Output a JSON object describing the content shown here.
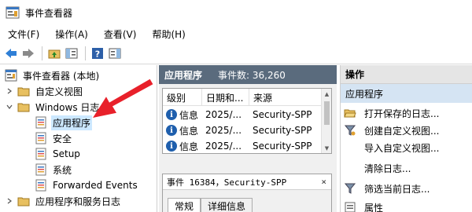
{
  "window": {
    "title": "事件查看器"
  },
  "menu": [
    "文件(F)",
    "操作(A)",
    "查看(V)",
    "帮助(H)"
  ],
  "tree": {
    "root": "事件查看器 (本地)",
    "custom_views": "自定义视图",
    "windows_logs": "Windows 日志",
    "logs": [
      "应用程序",
      "安全",
      "Setup",
      "系统",
      "Forwarded Events"
    ],
    "apps_services": "应用程序和服务日志"
  },
  "middle": {
    "header": "应用程序",
    "count_label": "事件数: 36,260",
    "columns": [
      "级别",
      "日期和...",
      "来源"
    ],
    "rows": [
      {
        "level": "信息",
        "date": "2025/...",
        "source": "Security-SPP"
      },
      {
        "level": "信息",
        "date": "2025/...",
        "source": "Security-SPP"
      },
      {
        "level": "信息",
        "date": "2025/...",
        "source": "Security-SPP"
      }
    ],
    "detail_title": "事件 16384，Security-SPP",
    "detail_close": "×",
    "tabs": [
      "常规",
      "详细信息"
    ]
  },
  "actions": {
    "header": "操作",
    "section": "应用程序",
    "items": [
      "打开保存的日志...",
      "创建自定义视图...",
      "导入自定义视图...",
      "清除日志...",
      "筛选当前日志...",
      "属性"
    ]
  },
  "colors": {
    "header_bg": "#5a6b7d",
    "selection": "#cce8ff",
    "arrow": "#e8202a",
    "info_icon": "#1f5fad"
  }
}
